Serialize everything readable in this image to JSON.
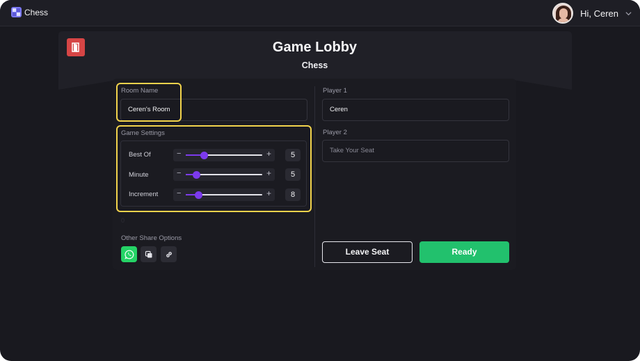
{
  "app": {
    "name": "Chess"
  },
  "user": {
    "greeting": "Hi, Ceren"
  },
  "lobby": {
    "title": "Game Lobby",
    "subtitle": "Chess"
  },
  "room": {
    "label": "Room Name",
    "value": "Ceren's Room"
  },
  "settings": {
    "label": "Game Settings",
    "items": [
      {
        "label": "Best Of",
        "value": "5",
        "fraction": 0.24
      },
      {
        "label": "Minute",
        "value": "5",
        "fraction": 0.14
      },
      {
        "label": "Increment",
        "value": "8",
        "fraction": 0.16
      }
    ]
  },
  "stray_text": "0",
  "share": {
    "label": "Other Share Options"
  },
  "players": {
    "p1_label": "Player 1",
    "p1_value": "Ceren",
    "p2_label": "Player 2",
    "p2_placeholder": "Take Your Seat"
  },
  "actions": {
    "leave": "Leave Seat",
    "ready": "Ready"
  },
  "colors": {
    "accent": "#7c3aed",
    "ready": "#22c16d",
    "highlight": "#f2d34c",
    "exit": "#d64545",
    "whatsapp": "#25d366"
  },
  "icons": [
    "chess-logo-icon",
    "chevron-down-icon",
    "exit-door-icon",
    "whatsapp-icon",
    "copy-icon",
    "link-icon"
  ]
}
